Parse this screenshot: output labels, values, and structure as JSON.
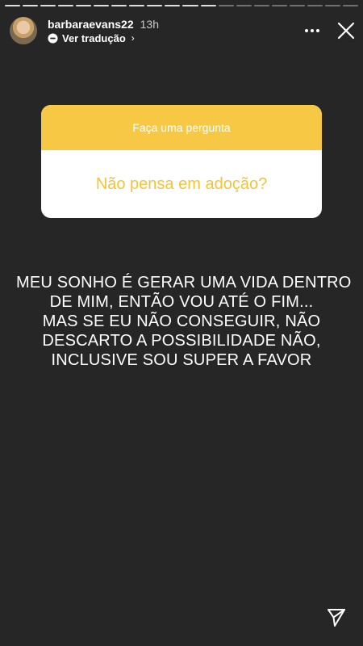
{
  "header": {
    "username": "barbaraevans22",
    "time": "13h",
    "translate_label": "Ver tradução",
    "chevron": "›"
  },
  "progress": {
    "segments": 20,
    "completed": 12
  },
  "question": {
    "title": "Faça uma pergunta",
    "text": "Não pensa em adoção?"
  },
  "answer": {
    "lines": [
      "MEU SONHO É GERAR UMA VIDA DENTRO",
      "DE MIM, ENTÃO VOU ATÉ O FIM...",
      "MAS SE EU NÃO CONSEGUIR, NÃO",
      "DESCARTO A POSSIBILIDADE NÃO,",
      "INCLUSIVE SOU SUPER A FAVOR"
    ]
  },
  "icons": {
    "translate": "translate-icon",
    "more": "more-icon",
    "close": "close-icon",
    "send": "send-icon"
  },
  "colors": {
    "background": "#262626",
    "question_header": "#f7c843",
    "question_text": "#f4c33a"
  }
}
